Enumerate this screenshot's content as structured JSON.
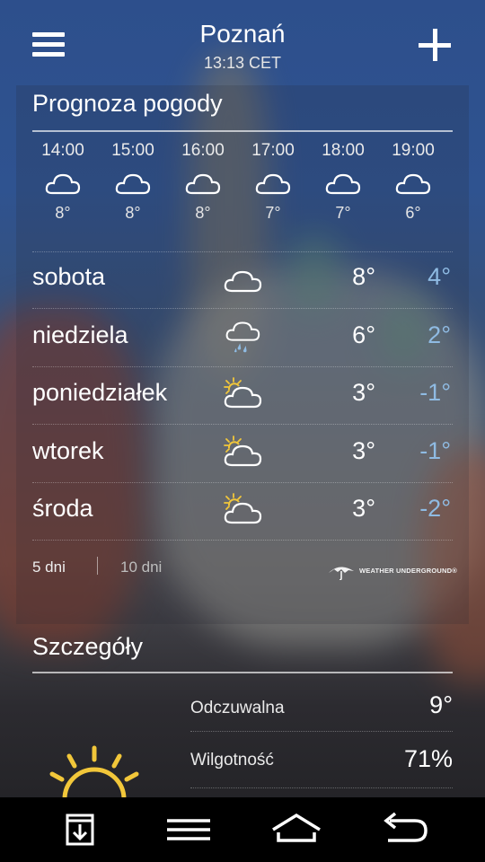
{
  "header": {
    "city": "Poznań",
    "time": "13:13 CET"
  },
  "forecast": {
    "title": "Prognoza pogody",
    "hourly": [
      {
        "time": "14:00",
        "temp": "8°",
        "icon": "cloud-icon"
      },
      {
        "time": "15:00",
        "temp": "8°",
        "icon": "cloud-icon"
      },
      {
        "time": "16:00",
        "temp": "8°",
        "icon": "cloud-icon"
      },
      {
        "time": "17:00",
        "temp": "7°",
        "icon": "cloud-icon"
      },
      {
        "time": "18:00",
        "temp": "7°",
        "icon": "cloud-icon"
      },
      {
        "time": "19:00",
        "temp": "6°",
        "icon": "cloud-icon"
      }
    ],
    "daily": [
      {
        "day": "sobota",
        "hi": "8°",
        "lo": "4°",
        "icon": "cloud-icon"
      },
      {
        "day": "niedziela",
        "hi": "6°",
        "lo": "2°",
        "icon": "rain-cloud-icon"
      },
      {
        "day": "poniedziałek",
        "hi": "3°",
        "lo": "-1°",
        "icon": "partly-cloudy-icon"
      },
      {
        "day": "wtorek",
        "hi": "3°",
        "lo": "-1°",
        "icon": "partly-cloudy-icon"
      },
      {
        "day": "środa",
        "hi": "3°",
        "lo": "-2°",
        "icon": "partly-cloudy-icon"
      }
    ],
    "tabs": {
      "five": "5 dni",
      "ten": "10 dni"
    },
    "provider": "WEATHER UNDERGROUND®"
  },
  "details": {
    "title": "Szczegóły",
    "rows": [
      {
        "label": "Odczuwalna",
        "value": "9°"
      },
      {
        "label": "Wilgotność",
        "value": "71%"
      }
    ]
  },
  "colors": {
    "low_temp": "#8fbbe3",
    "sun": "#f2c73a"
  },
  "nav": [
    "download-icon",
    "menu-icon",
    "home-icon",
    "back-icon"
  ]
}
